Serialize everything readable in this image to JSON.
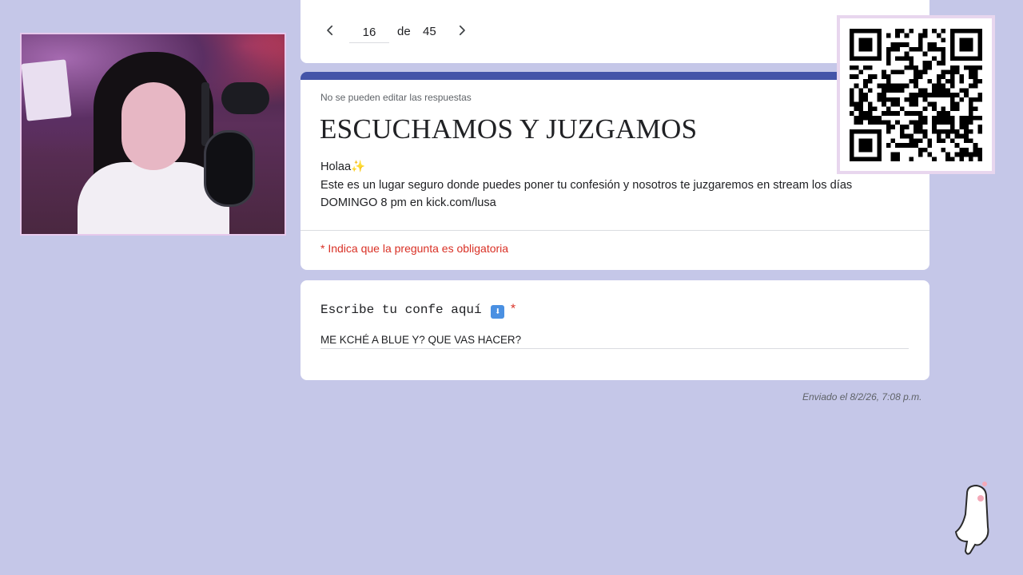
{
  "nav": {
    "page": "16",
    "of_label": "de",
    "total": "45"
  },
  "header": {
    "notice": "No se pueden editar las respuestas",
    "title": "ESCUCHAMOS Y JUZGAMOS",
    "description_lines": [
      "Holaa✨",
      "Este es un lugar seguro donde puedes poner tu confesión y nosotros te juzgaremos en stream los días",
      "DOMINGO 8 pm en kick.com/lusa"
    ],
    "required_note": "* Indica que la pregunta es obligatoria",
    "accent_color": "#4454a8"
  },
  "question": {
    "label": "Escribe tu confe aquí",
    "arrow_emoji": "⬇",
    "required_mark": "*",
    "answer": "ME KCHÉ A BLUE Y? QUE VAS HACER?"
  },
  "sent": "Enviado el 8/2/26, 7:08 p.m.",
  "icons": {
    "prev": "chevron-left-icon",
    "next": "chevron-right-icon"
  },
  "colors": {
    "background": "#c5c7e8",
    "required": "#d93025"
  }
}
